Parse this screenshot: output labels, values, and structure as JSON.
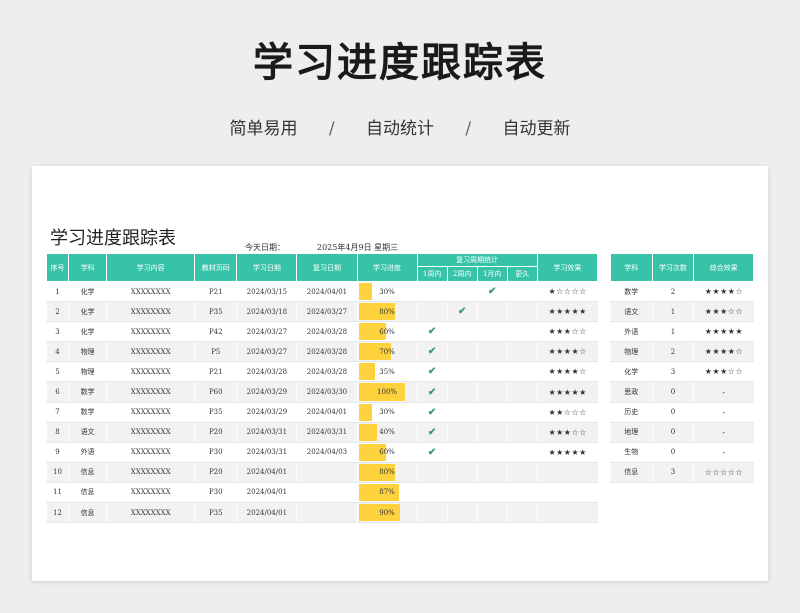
{
  "header": {
    "title": "学习进度跟踪表",
    "features": [
      "简单易用",
      "自动统计",
      "自动更新"
    ],
    "separator": "/"
  },
  "sheet": {
    "title": "学习进度跟踪表",
    "today_label": "今天日期：",
    "today_value": "2025年4月9日  星期三"
  },
  "main_table": {
    "headers": {
      "index": "序号",
      "subject": "学科",
      "content": "学习内容",
      "page": "教材页码",
      "study_date": "学习日期",
      "review_date": "复习日期",
      "progress": "学习进度",
      "review_stats": "复习周期统计",
      "within_1w": "1周内",
      "within_2w": "2周内",
      "within_1m": "1月内",
      "longer": "更久",
      "effect": "学习效果"
    },
    "rows": [
      {
        "index": "1",
        "subject": "化学",
        "content": "XXXXXXXX",
        "page": "P21",
        "study_date": "2024/03/15",
        "review_date": "2024/04/01",
        "progress": 0.3,
        "progress_label": "30%",
        "w1": "",
        "w2": "",
        "m1": "✔",
        "longer": "",
        "effect": "★☆☆☆☆"
      },
      {
        "index": "2",
        "subject": "化学",
        "content": "XXXXXXXX",
        "page": "P35",
        "study_date": "2024/03/18",
        "review_date": "2024/03/27",
        "progress": 0.8,
        "progress_label": "80%",
        "w1": "",
        "w2": "✔",
        "m1": "",
        "longer": "",
        "effect": "★★★★★"
      },
      {
        "index": "3",
        "subject": "化学",
        "content": "XXXXXXXX",
        "page": "P42",
        "study_date": "2024/03/27",
        "review_date": "2024/03/28",
        "progress": 0.6,
        "progress_label": "60%",
        "w1": "✔",
        "w2": "",
        "m1": "",
        "longer": "",
        "effect": "★★★☆☆"
      },
      {
        "index": "4",
        "subject": "物理",
        "content": "XXXXXXXX",
        "page": "P5",
        "study_date": "2024/03/27",
        "review_date": "2024/03/28",
        "progress": 0.7,
        "progress_label": "70%",
        "w1": "✔",
        "w2": "",
        "m1": "",
        "longer": "",
        "effect": "★★★★☆"
      },
      {
        "index": "5",
        "subject": "物理",
        "content": "XXXXXXXX",
        "page": "P21",
        "study_date": "2024/03/28",
        "review_date": "2024/03/28",
        "progress": 0.35,
        "progress_label": "35%",
        "w1": "✔",
        "w2": "",
        "m1": "",
        "longer": "",
        "effect": "★★★★☆"
      },
      {
        "index": "6",
        "subject": "数学",
        "content": "XXXXXXXX",
        "page": "P60",
        "study_date": "2024/03/29",
        "review_date": "2024/03/30",
        "progress": 1.0,
        "progress_label": "100%",
        "w1": "✔",
        "w2": "",
        "m1": "",
        "longer": "",
        "effect": "★★★★★"
      },
      {
        "index": "7",
        "subject": "数学",
        "content": "XXXXXXXX",
        "page": "P35",
        "study_date": "2024/03/29",
        "review_date": "2024/04/01",
        "progress": 0.3,
        "progress_label": "30%",
        "w1": "✔",
        "w2": "",
        "m1": "",
        "longer": "",
        "effect": "★★☆☆☆"
      },
      {
        "index": "8",
        "subject": "语文",
        "content": "XXXXXXXX",
        "page": "P20",
        "study_date": "2024/03/31",
        "review_date": "2024/03/31",
        "progress": 0.4,
        "progress_label": "40%",
        "w1": "✔",
        "w2": "",
        "m1": "",
        "longer": "",
        "effect": "★★★☆☆"
      },
      {
        "index": "9",
        "subject": "外语",
        "content": "XXXXXXXX",
        "page": "P30",
        "study_date": "2024/03/31",
        "review_date": "2024/04/03",
        "progress": 0.6,
        "progress_label": "60%",
        "w1": "✔",
        "w2": "",
        "m1": "",
        "longer": "",
        "effect": "★★★★★"
      },
      {
        "index": "10",
        "subject": "信息",
        "content": "XXXXXXXX",
        "page": "P20",
        "study_date": "2024/04/01",
        "review_date": "",
        "progress": 0.8,
        "progress_label": "80%",
        "w1": "",
        "w2": "",
        "m1": "",
        "longer": "",
        "effect": ""
      },
      {
        "index": "11",
        "subject": "信息",
        "content": "XXXXXXXX",
        "page": "P30",
        "study_date": "2024/04/01",
        "review_date": "",
        "progress": 0.87,
        "progress_label": "87%",
        "w1": "",
        "w2": "",
        "m1": "",
        "longer": "",
        "effect": ""
      },
      {
        "index": "12",
        "subject": "信息",
        "content": "XXXXXXXX",
        "page": "P35",
        "study_date": "2024/04/01",
        "review_date": "",
        "progress": 0.9,
        "progress_label": "90%",
        "w1": "",
        "w2": "",
        "m1": "",
        "longer": "",
        "effect": ""
      }
    ]
  },
  "summary_table": {
    "headers": {
      "subject": "学科",
      "count": "学习次数",
      "effect": "综合效果"
    },
    "rows": [
      {
        "subject": "数学",
        "count": "2",
        "effect": "★★★★☆"
      },
      {
        "subject": "语文",
        "count": "1",
        "effect": "★★★☆☆"
      },
      {
        "subject": "外语",
        "count": "1",
        "effect": "★★★★★"
      },
      {
        "subject": "物理",
        "count": "2",
        "effect": "★★★★☆"
      },
      {
        "subject": "化学",
        "count": "3",
        "effect": "★★★☆☆"
      },
      {
        "subject": "思政",
        "count": "0",
        "effect": "-"
      },
      {
        "subject": "历史",
        "count": "0",
        "effect": "-"
      },
      {
        "subject": "地理",
        "count": "0",
        "effect": "-"
      },
      {
        "subject": "生物",
        "count": "0",
        "effect": "-"
      },
      {
        "subject": "信息",
        "count": "3",
        "effect": "☆☆☆☆☆"
      }
    ]
  },
  "colors": {
    "header_teal": "#36c3a8",
    "progress_bar": "#fdd23c",
    "check": "#3a9a7c"
  }
}
